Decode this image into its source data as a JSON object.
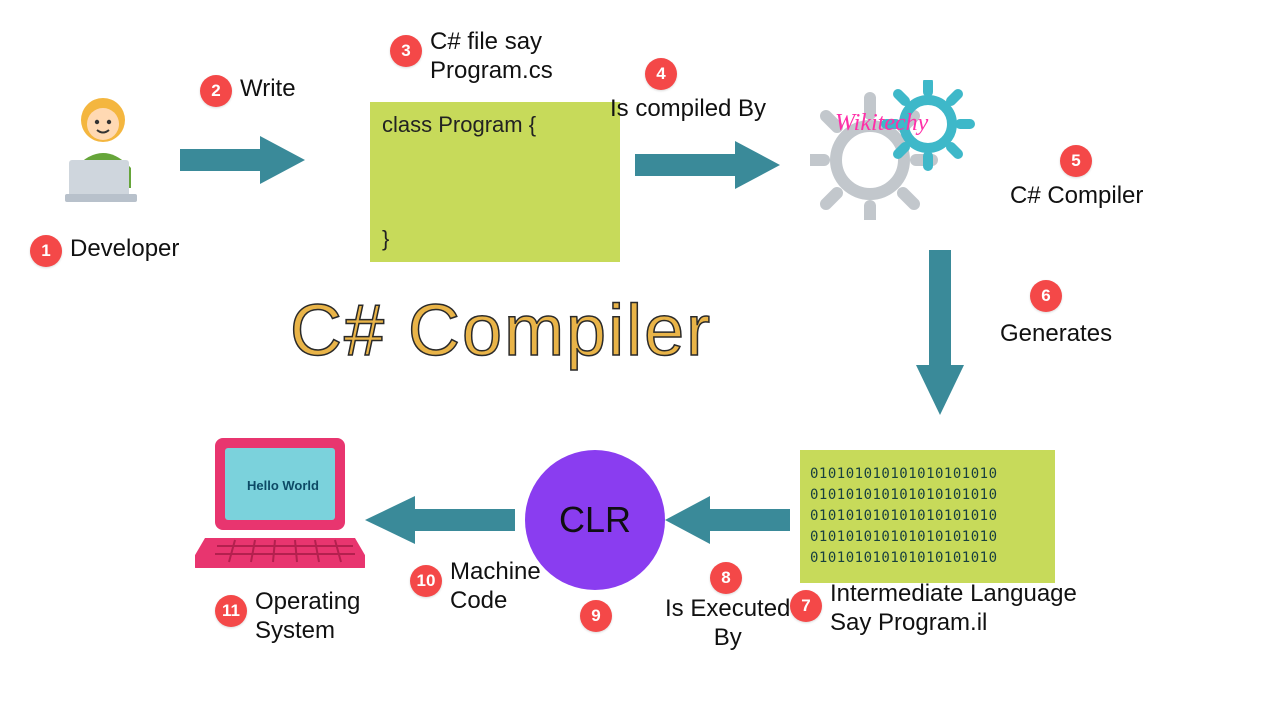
{
  "title": "C# Compiler",
  "watermark": "Wikitechy",
  "clr_label": "CLR",
  "screen_text": "Hello World",
  "code": {
    "open": "class Program {",
    "close": "}"
  },
  "il_lines": [
    "010101010101010101010",
    "010101010101010101010",
    "010101010101010101010",
    "010101010101010101010",
    "010101010101010101010"
  ],
  "steps": {
    "1": {
      "num": "1",
      "label": "Developer"
    },
    "2": {
      "num": "2",
      "label": "Write"
    },
    "3": {
      "num": "3",
      "label": "C# file say\nProgram.cs"
    },
    "4": {
      "num": "4",
      "label": "Is compiled By"
    },
    "5": {
      "num": "5",
      "label": "C# Compiler"
    },
    "6": {
      "num": "6",
      "label": "Generates"
    },
    "7": {
      "num": "7",
      "label": "Intermediate Language\nSay Program.il"
    },
    "8": {
      "num": "8",
      "label": "Is Executed\nBy"
    },
    "9": {
      "num": "9",
      "label": ""
    },
    "10": {
      "num": "10",
      "label": "Machine\nCode"
    },
    "11": {
      "num": "11",
      "label": "Operating\nSystem"
    }
  },
  "colors": {
    "arrow": "#3a8a99",
    "badge": "#f44848",
    "code_bg": "#c7da5a",
    "clr": "#8a3df0",
    "laptop": "#e8356f",
    "screen": "#7bd2dc"
  }
}
